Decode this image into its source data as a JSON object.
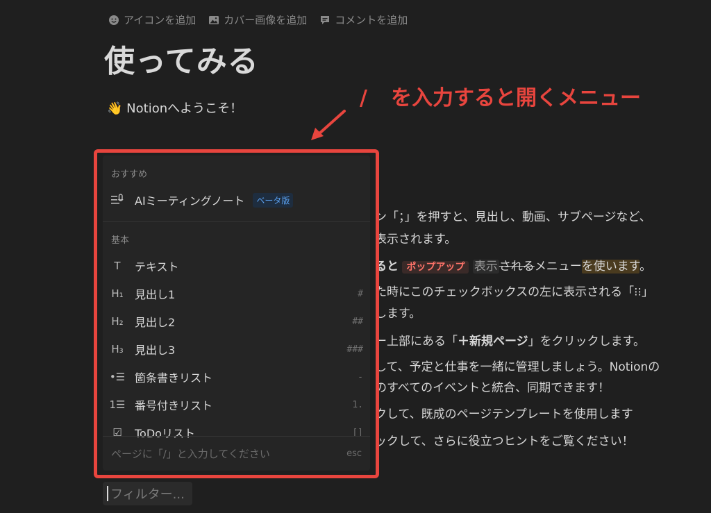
{
  "page_actions": {
    "add_icon": "アイコンを追加",
    "add_cover": "カバー画像を追加",
    "add_comment": "コメントを追加"
  },
  "page": {
    "title": "使ってみる",
    "welcome_emoji": "👋",
    "welcome_text": "Notionへようこそ！"
  },
  "annotation": {
    "slash": "/",
    "text": "を入力すると開くメニュー",
    "color": "#e8453e"
  },
  "background_lines": {
    "l1": "ン「；」を押すと、見出し、動画、サブページなど、",
    "l2": "表示されます。",
    "l3_a": "ると",
    "l3_tag": "ポップアップ",
    "l3_gray": "表示",
    "l3_strike": "される",
    "l3_b": "メニュー",
    "l3_hl": "を使います",
    "l3_c": "。",
    "l4": "た時にこのチェックボックスの左に表示される「⁝⁝」",
    "l5": "します。",
    "l6_a": "ー上部にある「",
    "l6_b": "＋新規ページ",
    "l6_c": "」をクリックします。",
    "l7": "して、予定と仕事を一緒に管理しましょう。Notionの",
    "l8": "のすべてのイベントと統合、同期できます！",
    "l9": "クして、既成のページテンプレートを使用します",
    "l10": "ックして、さらに役立つヒントをご覧ください！"
  },
  "menu": {
    "section_recommended": "おすすめ",
    "ai_item": {
      "label": "AIミーティングノート",
      "badge": "ベータ版",
      "icon": "ai-meeting-icon"
    },
    "section_basic": "基本",
    "items": [
      {
        "label": "テキスト",
        "icon_glyph": "T",
        "shortcut": ""
      },
      {
        "label": "見出し1",
        "icon_glyph": "H₁",
        "shortcut": "#"
      },
      {
        "label": "見出し2",
        "icon_glyph": "H₂",
        "shortcut": "##"
      },
      {
        "label": "見出し3",
        "icon_glyph": "H₃",
        "shortcut": "###"
      },
      {
        "label": "箇条書きリスト",
        "icon_glyph": "•☰",
        "shortcut": "-"
      },
      {
        "label": "番号付きリスト",
        "icon_glyph": "1☰",
        "shortcut": "1."
      },
      {
        "label": "ToDoリスト",
        "icon_glyph": "☑",
        "shortcut": "[]"
      }
    ],
    "footer_hint": "ページに「/」と入力してください",
    "footer_esc": "esc"
  },
  "filter": {
    "placeholder": "フィルター..."
  },
  "colors": {
    "background": "#1f1f1f",
    "menu_bg": "#252525",
    "highlight_border": "#e8453e",
    "badge_blue": "#5aa0ef"
  }
}
